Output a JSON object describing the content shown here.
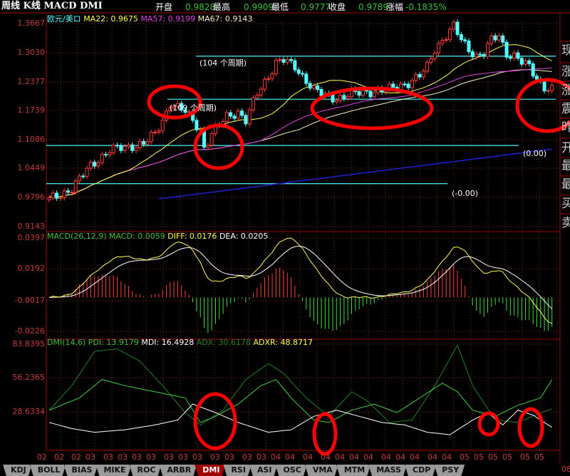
{
  "header": {
    "title": "周线 K线 MACD DMI",
    "fields": [
      {
        "label": "开盘",
        "value": "0.9828"
      },
      {
        "label": "最高",
        "value": "0.9909"
      },
      {
        "label": "最低",
        "value": "0.9777"
      },
      {
        "label": "收盘",
        "value": "0.9789"
      },
      {
        "label": "涨幅",
        "value": "-0.1835%"
      }
    ]
  },
  "main_panel": {
    "symbol": "欧元/美ロ",
    "ma22": "MA22: 0.9675",
    "ma57": "MA57: 0.9199",
    "ma67": "MA67: 0.9143",
    "y_ticks": [
      "1.3667",
      "1.3030",
      "1.2377",
      "1.1739",
      "1.1086",
      "1.0449",
      "0.9796",
      "0.9143"
    ],
    "annotations": [
      "(104 个周期)",
      "(109 个周期)",
      "(0.00)",
      "(-0.00)"
    ],
    "levels": [
      1.294,
      1.198,
      1.095,
      1.01
    ],
    "price_waypoints": [
      [
        0,
        0.975
      ],
      [
        3,
        0.985
      ],
      [
        6,
        1.0
      ],
      [
        11,
        1.05
      ],
      [
        16,
        1.085
      ],
      [
        20,
        1.09
      ],
      [
        25,
        1.1
      ],
      [
        28,
        1.12
      ],
      [
        30,
        1.15
      ],
      [
        32,
        1.19
      ],
      [
        34,
        1.18
      ],
      [
        36,
        1.17
      ],
      [
        38,
        1.15
      ],
      [
        40,
        1.13
      ],
      [
        41,
        1.09
      ],
      [
        43,
        1.12
      ],
      [
        45,
        1.14
      ],
      [
        47,
        1.16
      ],
      [
        50,
        1.17
      ],
      [
        52,
        1.15
      ],
      [
        55,
        1.21
      ],
      [
        58,
        1.25
      ],
      [
        60,
        1.28
      ],
      [
        62,
        1.285
      ],
      [
        65,
        1.27
      ],
      [
        67,
        1.25
      ],
      [
        70,
        1.22
      ],
      [
        73,
        1.205
      ],
      [
        76,
        1.2
      ],
      [
        80,
        1.21
      ],
      [
        85,
        1.215
      ],
      [
        90,
        1.22
      ],
      [
        95,
        1.235
      ],
      [
        98,
        1.25
      ],
      [
        100,
        1.27
      ],
      [
        102,
        1.31
      ],
      [
        105,
        1.34
      ],
      [
        107,
        1.36
      ],
      [
        109,
        1.33
      ],
      [
        111,
        1.31
      ],
      [
        113,
        1.295
      ],
      [
        115,
        1.3
      ],
      [
        117,
        1.33
      ],
      [
        119,
        1.34
      ],
      [
        121,
        1.3
      ],
      [
        123,
        1.295
      ],
      [
        125,
        1.28
      ],
      [
        127,
        1.27
      ],
      [
        129,
        1.245
      ],
      [
        131,
        1.225
      ],
      [
        133,
        1.22
      ]
    ],
    "colors": {
      "up": "#ff3c3c",
      "down": "#54ffff",
      "ma22": "#ffff50",
      "ma57": "#e040e0",
      "ma67": "#f0f0c0",
      "long_ma": "#2020d0",
      "level": "#40e0e0"
    }
  },
  "macd_panel": {
    "label": "MACD(26,12,9)",
    "macd": "MACD: 0.0059",
    "diff": "DIFF: 0.0176",
    "dea": "DEA: 0.0205",
    "y_ticks": [
      "0.0397",
      "0.0192",
      "-0.0017",
      "-0.0226"
    ]
  },
  "dmi_panel": {
    "label": "DMI(14,6)",
    "pdi": "PDI: 13.9179",
    "mdi": "MDI: 16.4928",
    "adx": "ADX: 30.6178",
    "adxr": "ADXR: 48.8717",
    "y_ticks": [
      "83.8395",
      "56.2365",
      "28.6334"
    ],
    "pdi_waypoints": [
      [
        0,
        30
      ],
      [
        8,
        40
      ],
      [
        14,
        55
      ],
      [
        20,
        50
      ],
      [
        28,
        45
      ],
      [
        36,
        40
      ],
      [
        40,
        20
      ],
      [
        44,
        25
      ],
      [
        50,
        35
      ],
      [
        56,
        50
      ],
      [
        60,
        55
      ],
      [
        64,
        40
      ],
      [
        70,
        22
      ],
      [
        74,
        20
      ],
      [
        80,
        30
      ],
      [
        86,
        35
      ],
      [
        92,
        28
      ],
      [
        98,
        40
      ],
      [
        104,
        52
      ],
      [
        108,
        45
      ],
      [
        112,
        30
      ],
      [
        118,
        25
      ],
      [
        124,
        34
      ],
      [
        130,
        40
      ],
      [
        133,
        55
      ]
    ],
    "mdi_waypoints": [
      [
        0,
        20
      ],
      [
        6,
        15
      ],
      [
        12,
        12
      ],
      [
        20,
        14
      ],
      [
        28,
        18
      ],
      [
        34,
        22
      ],
      [
        38,
        35
      ],
      [
        44,
        28
      ],
      [
        50,
        20
      ],
      [
        58,
        12
      ],
      [
        64,
        14
      ],
      [
        70,
        25
      ],
      [
        76,
        30
      ],
      [
        82,
        25
      ],
      [
        88,
        20
      ],
      [
        94,
        18
      ],
      [
        100,
        12
      ],
      [
        106,
        10
      ],
      [
        112,
        22
      ],
      [
        116,
        28
      ],
      [
        120,
        18
      ],
      [
        124,
        30
      ],
      [
        128,
        26
      ],
      [
        133,
        16
      ]
    ],
    "adx_waypoints": [
      [
        0,
        30
      ],
      [
        6,
        50
      ],
      [
        12,
        78
      ],
      [
        18,
        80
      ],
      [
        24,
        70
      ],
      [
        30,
        50
      ],
      [
        36,
        28
      ],
      [
        40,
        18
      ],
      [
        46,
        30
      ],
      [
        52,
        55
      ],
      [
        58,
        68
      ],
      [
        62,
        60
      ],
      [
        68,
        40
      ],
      [
        74,
        25
      ],
      [
        80,
        45
      ],
      [
        84,
        38
      ],
      [
        90,
        20
      ],
      [
        96,
        22
      ],
      [
        102,
        50
      ],
      [
        108,
        83
      ],
      [
        112,
        50
      ],
      [
        118,
        22
      ],
      [
        124,
        20
      ],
      [
        130,
        28
      ],
      [
        133,
        31
      ]
    ],
    "colors": {
      "pdi": "#40d040",
      "mdi": "#ffffff",
      "adx": "#208020"
    }
  },
  "x_axis": {
    "labels": [
      "02",
      "02",
      "02",
      "03",
      "03",
      "03",
      "03",
      "03",
      "03",
      "03",
      "03",
      "03",
      "03",
      "03",
      "03",
      "04",
      "04",
      "04",
      "04",
      "04",
      "04",
      "04",
      "04",
      "04",
      "04",
      "04",
      "04",
      "05",
      "05",
      "05",
      "05",
      "05",
      "05"
    ],
    "corner": "08"
  },
  "side_panel": {
    "labels": [
      "现",
      "涨",
      "涨",
      "震",
      "昨",
      "开",
      "最",
      "最",
      "买",
      "卖"
    ]
  },
  "tabs": [
    {
      "label": "KDJ"
    },
    {
      "label": "BOLL"
    },
    {
      "label": "BIAS"
    },
    {
      "label": "MIKE"
    },
    {
      "label": "ROC"
    },
    {
      "label": "ARBR"
    },
    {
      "label": "DMI",
      "active": true
    },
    {
      "label": "RSI"
    },
    {
      "label": "ASI"
    },
    {
      "label": "OSC"
    },
    {
      "label": "VMA"
    },
    {
      "label": "MTM"
    },
    {
      "label": "MASS"
    },
    {
      "label": "CDP"
    },
    {
      "label": "PSY"
    }
  ]
}
